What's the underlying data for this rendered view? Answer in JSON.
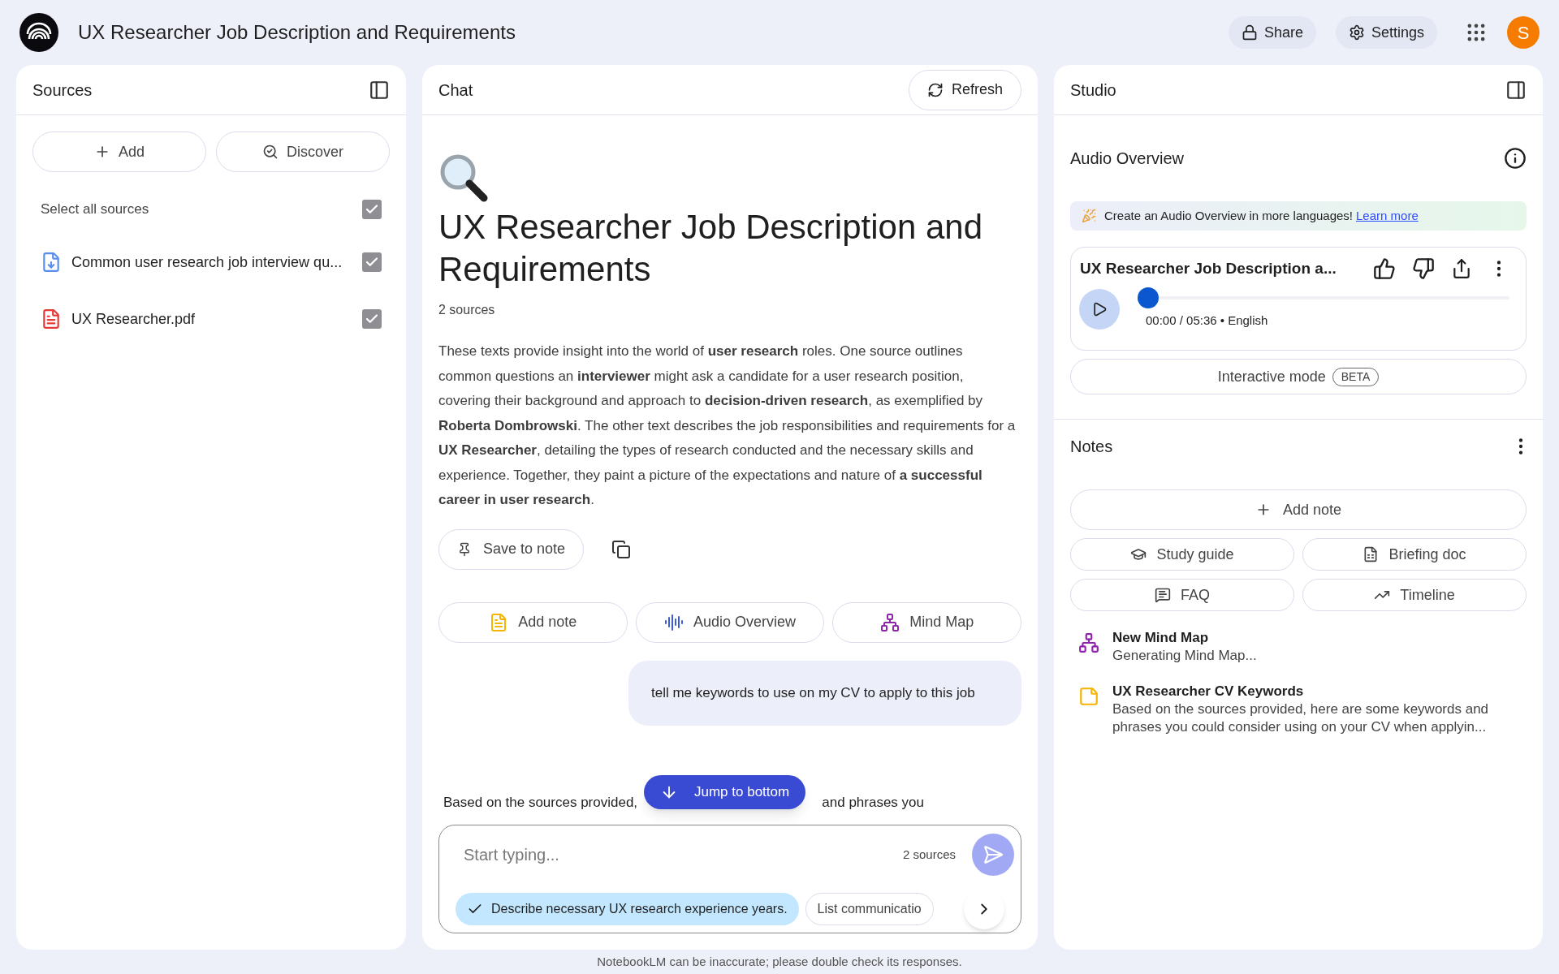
{
  "header": {
    "title": "UX Researcher Job Description and Requirements",
    "buttons": [
      {
        "kind": "share",
        "label": "Share"
      },
      {
        "kind": "settings",
        "label": "Settings"
      }
    ],
    "avatar": "S"
  },
  "sources": {
    "title": "Sources",
    "actions": [
      {
        "kind": "add",
        "label": "Add"
      },
      {
        "kind": "discover",
        "label": "Discover"
      }
    ],
    "select_all": {
      "label": "Select all sources",
      "checked": true
    },
    "items": [
      {
        "kind": "markdown",
        "name": "Common user research job interview qu...",
        "checked": true
      },
      {
        "kind": "pdf",
        "name": "UX Researcher.pdf",
        "checked": true
      }
    ]
  },
  "chat": {
    "title": "Chat",
    "refresh": "Refresh",
    "heading": "UX Researcher Job Description and Requirements",
    "source_count": "2 sources",
    "summary": "These texts provide insight into the world of **user research** roles. One source outlines common questions an **interviewer** might ask a candidate for a user research position, covering their background and approach to **decision-driven research**, as exemplified by **Roberta Dombrowski**. The other text describes the job responsibilities and requirements for a **UX Researcher**, detailing the types of research conducted and the necessary skills and experience. Together, they paint a picture of the expectations and nature of **a successful career in user research**.",
    "save_to_note": "Save to note",
    "quick_actions": [
      {
        "kind": "note",
        "label": "Add note"
      },
      {
        "kind": "audio",
        "label": "Audio Overview"
      },
      {
        "kind": "mindmap",
        "label": "Mind Map"
      }
    ],
    "user_message": "tell me keywords to use on my CV to apply to this job",
    "reply_start": "Based on the sources provided,",
    "reply_end": "and phrases you",
    "jump": "Jump to bottom",
    "input": {
      "placeholder": "Start typing...",
      "source_count": "2 sources"
    },
    "suggestions": [
      {
        "label": "Describe necessary UX research experience years.",
        "selected": true
      },
      {
        "label": "List communicatio",
        "selected": false
      }
    ]
  },
  "studio": {
    "title": "Studio",
    "audio_overview": {
      "title": "Audio Overview",
      "banner": "Create an Audio Overview in more languages!",
      "banner_link": "Learn more",
      "track_title": "UX Researcher Job Description a...",
      "level": 0,
      "time": "00:00 / 05:36 • English",
      "interactive": "Interactive mode",
      "badge": "BETA"
    },
    "notes": {
      "title": "Notes",
      "add": "Add note",
      "actions": [
        {
          "kind": "study",
          "label": "Study guide"
        },
        {
          "kind": "briefing",
          "label": "Briefing doc"
        },
        {
          "kind": "faq",
          "label": "FAQ"
        },
        {
          "kind": "timeline",
          "label": "Timeline"
        }
      ],
      "items": [
        {
          "kind": "mindmap",
          "title": "New Mind Map",
          "text": "Generating Mind Map..."
        },
        {
          "kind": "note",
          "title": "UX Researcher CV Keywords",
          "text": "Based on the sources provided, here are some keywords and phrases you could consider using on your CV when applyin..."
        }
      ]
    }
  },
  "footer": "NotebookLM can be inaccurate; please double check its responses."
}
